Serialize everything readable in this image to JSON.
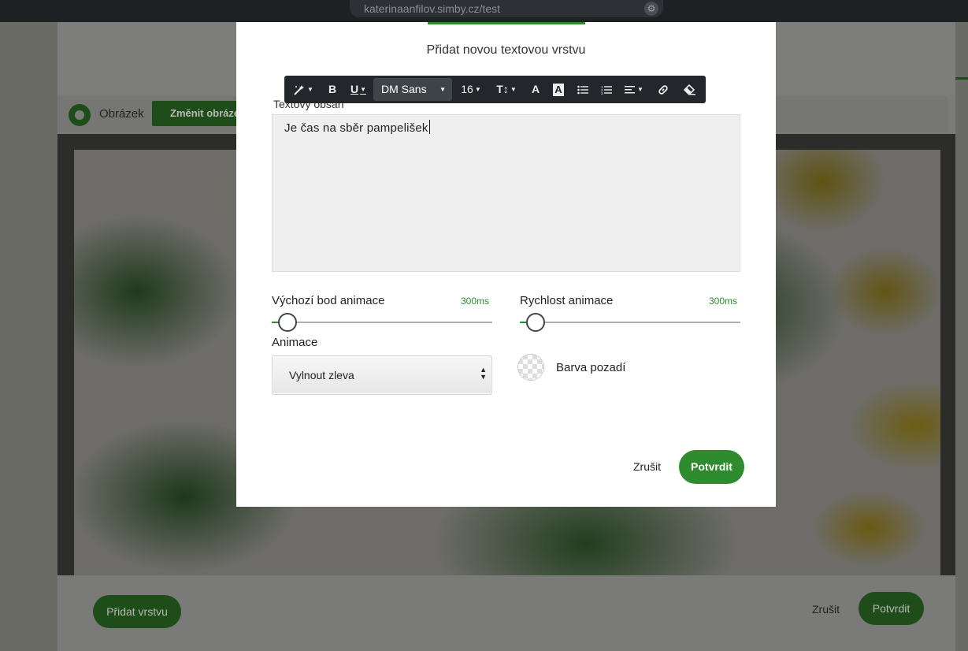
{
  "browser": {
    "url": "katerinaanfilov.simby.cz/test",
    "icon": "gear-icon"
  },
  "background": {
    "radio_label": "Obrázek",
    "change_button": "Změnit obráze",
    "add_layer_button": "Přidat vrstvu",
    "cancel": "Zrušit",
    "confirm": "Potvrdit"
  },
  "modal": {
    "title": "Přidat novou textovou vrstvu",
    "content_label": "Textový obsah",
    "editor_text": "Je čas na sběr pampelišek",
    "toolbar": {
      "font_family": "DM Sans",
      "font_size": "16",
      "icons": [
        "magic-icon",
        "bold-icon",
        "underline-icon",
        "font-family-select",
        "font-size-select",
        "line-height-icon",
        "font-color-icon",
        "highlight-icon",
        "bullet-list-icon",
        "numbered-list-icon",
        "align-icon",
        "link-icon",
        "eraser-icon"
      ]
    },
    "slider_start": {
      "label": "Výchozí bod animace",
      "value": "300ms",
      "level": 0.07
    },
    "slider_speed": {
      "label": "Rychlost animace",
      "value": "300ms",
      "level": 0.07
    },
    "animation_label": "Animace",
    "animation_select": {
      "value": "Vylnout zleva"
    },
    "background_color_label": "Barva pozadí",
    "cancel": "Zrušit",
    "confirm": "Potvrdit",
    "accent_color": "#2e8b2e"
  }
}
